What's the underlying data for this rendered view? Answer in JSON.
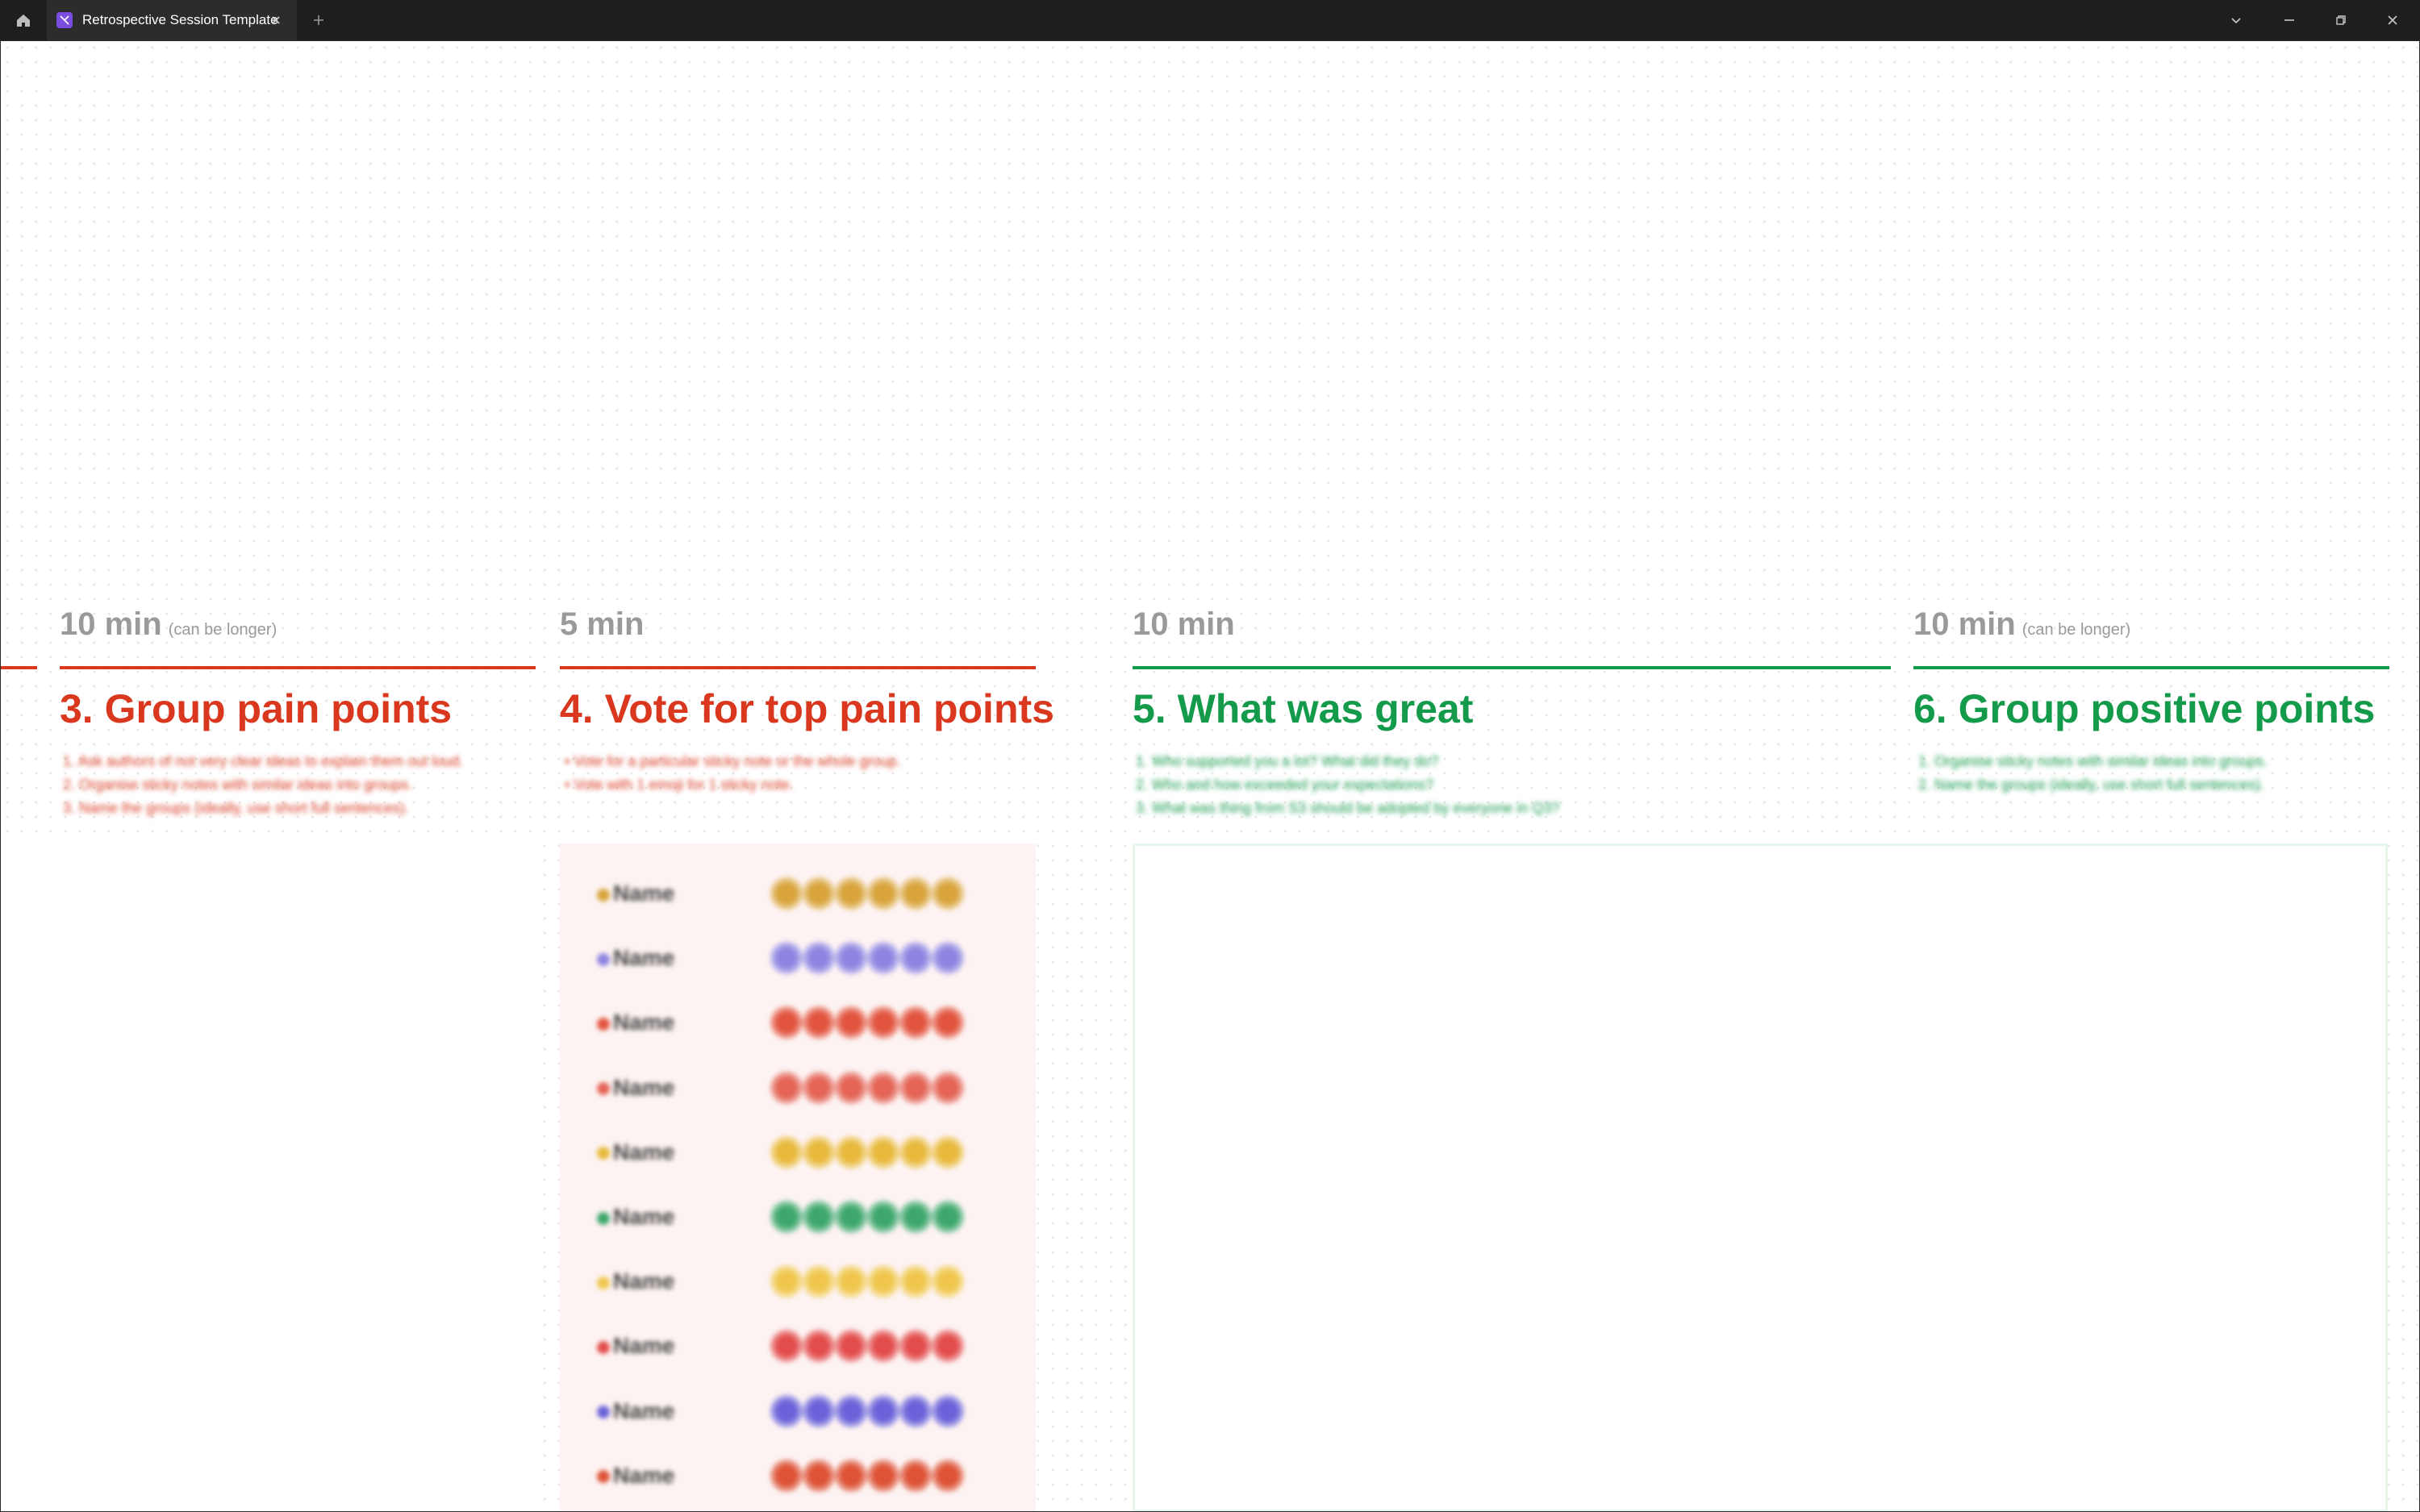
{
  "window": {
    "tab_title": "Retrospective Session Template",
    "new_tab_symbol": "+",
    "icons": [
      "home-icon",
      "figjam-file-icon",
      "close-icon",
      "plus-icon",
      "chevron-down-icon",
      "minimize-icon",
      "restore-icon",
      "close-window-icon"
    ]
  },
  "sections": [
    {
      "time": "10 min",
      "time_note": "(can be longer)",
      "title": "3. Group pain points",
      "color": "#d9381e",
      "instructions": [
        "1. Ask authors of not very clear ideas to explain them out loud.",
        "2. Organise sticky notes with similar ideas into groups.",
        "3. Name the groups (ideally, use short full sentences)."
      ]
    },
    {
      "time": "5 min",
      "time_note": "",
      "title": "4. Vote for top pain points",
      "color": "#d9381e",
      "instructions": [
        "• Vote for a particular sticky note or the whole group.",
        "• Vote with 1 emoji for 1 sticky note."
      ]
    },
    {
      "time": "10 min",
      "time_note": "",
      "title": "5. What was great",
      "color": "#139a4a",
      "instructions": [
        "1. Who supported you a lot? What did they do?",
        "2. Who and how exceeded your expectations?",
        "3. What was thing from S3 should be adopted by everyone in Q3?"
      ]
    },
    {
      "time": "10 min",
      "time_note": "(can be longer)",
      "title": "6. Group positive points",
      "color": "#139a4a",
      "instructions": [
        "1. Organise sticky notes with similar ideas into groups.",
        "2. Name the groups (ideally, use short full sentences)."
      ]
    }
  ],
  "voters": [
    {
      "name": "Name",
      "color": "#d9a43c",
      "icon": "crown-icon"
    },
    {
      "name": "Name",
      "color": "#8e84e0",
      "icon": "thumbs-up-icon"
    },
    {
      "name": "Name",
      "color": "#e2543f",
      "icon": "pin-icon"
    },
    {
      "name": "Name",
      "color": "#e46355",
      "icon": "target-icon"
    },
    {
      "name": "Name",
      "color": "#e8b93c",
      "icon": "star-icon"
    },
    {
      "name": "Name",
      "color": "#3ea76c",
      "icon": "clover-icon"
    },
    {
      "name": "Name",
      "color": "#f0c64e",
      "icon": "bulb-icon"
    },
    {
      "name": "Name",
      "color": "#e34c4c",
      "icon": "heart-icon"
    },
    {
      "name": "Name",
      "color": "#6b62d9",
      "icon": "ring-icon"
    },
    {
      "name": "Name",
      "color": "#de5236",
      "icon": "drop-icon"
    }
  ]
}
